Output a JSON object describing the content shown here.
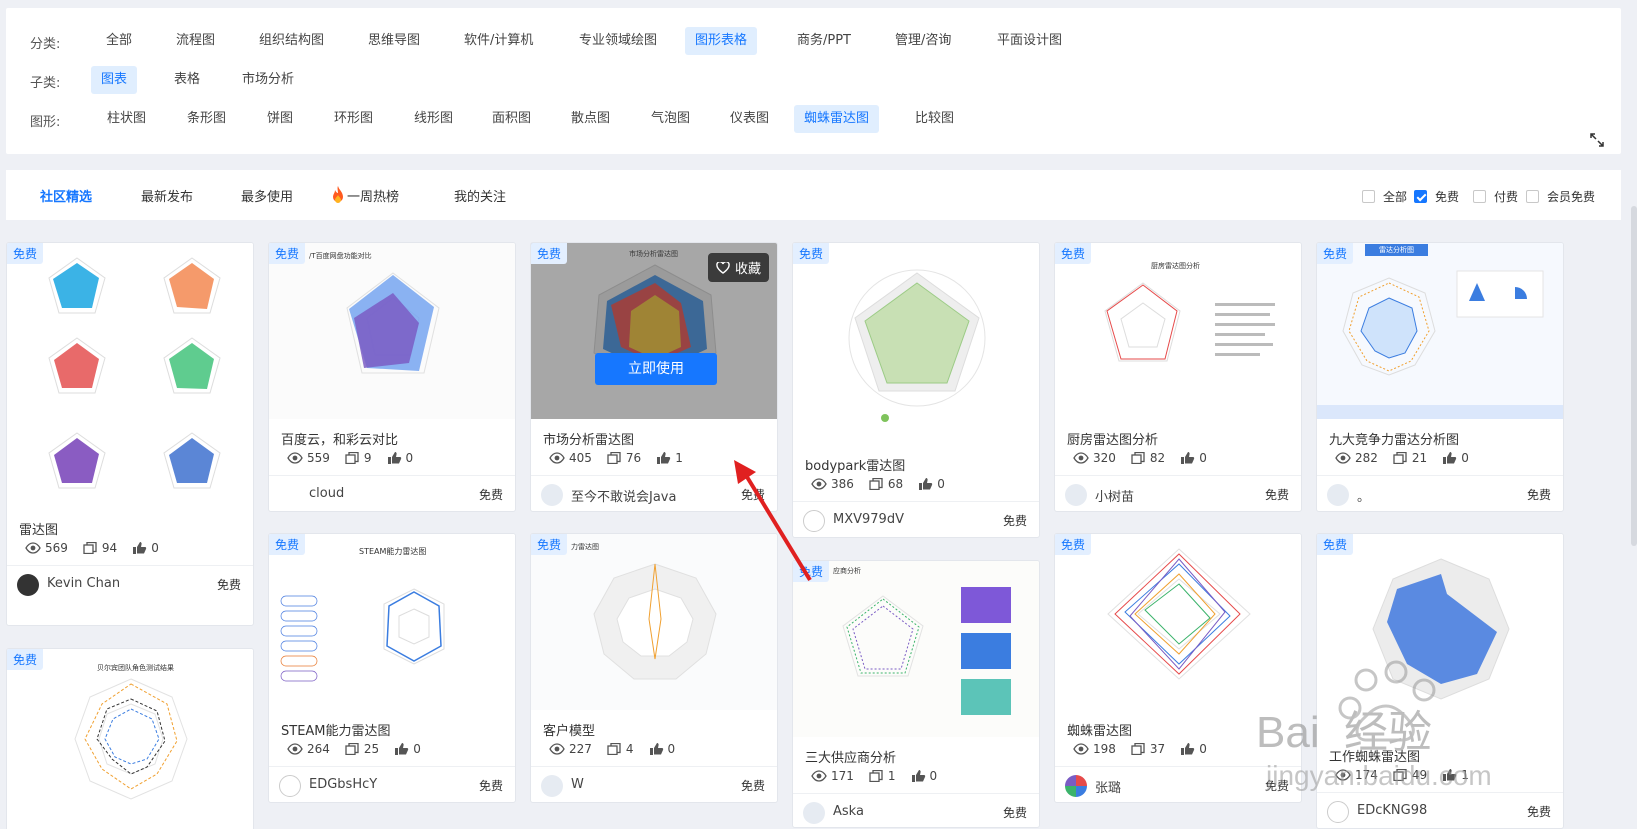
{
  "filters": {
    "category_label": "分类:",
    "categories": [
      "全部",
      "流程图",
      "组织结构图",
      "思维导图",
      "软件/计算机",
      "专业领域绘图",
      "图形表格",
      "商务/PPT",
      "管理/咨询",
      "平面设计图"
    ],
    "subcategory_label": "子类:",
    "subcategories": [
      "图表",
      "表格",
      "市场分析"
    ],
    "shape_label": "图形:",
    "shapes": [
      "柱状图",
      "条形图",
      "饼图",
      "环形图",
      "线形图",
      "面积图",
      "散点图",
      "气泡图",
      "仪表图",
      "蜘蛛雷达图",
      "比较图"
    ]
  },
  "tabs": [
    "社区精选",
    "最新发布",
    "最多使用",
    "一周热榜",
    "我的关注"
  ],
  "price_filters": [
    {
      "label": "全部",
      "checked": false
    },
    {
      "label": "免费",
      "checked": true
    },
    {
      "label": "付费",
      "checked": false
    },
    {
      "label": "会员免费",
      "checked": false
    }
  ],
  "badge_label": "免费",
  "overlay": {
    "favorite_label": "收藏",
    "use_label": "立即使用"
  },
  "cards": [
    {
      "title": "雷达图",
      "views": "569",
      "copies": "94",
      "likes": "0",
      "author": "Kevin Chan",
      "price": "免费"
    },
    {
      "title": "百度云，和彩云对比",
      "views": "559",
      "copies": "9",
      "likes": "0",
      "author": "cloud",
      "price": "免费"
    },
    {
      "title": "市场分析雷达图",
      "views": "405",
      "copies": "76",
      "likes": "1",
      "author": "至今不敢说会Java",
      "price": "免费"
    },
    {
      "title": "bodypark雷达图",
      "views": "386",
      "copies": "68",
      "likes": "0",
      "author": "MXV979dV",
      "price": "免费"
    },
    {
      "title": "厨房雷达图分析",
      "views": "320",
      "copies": "82",
      "likes": "0",
      "author": "小树苗",
      "price": "免费"
    },
    {
      "title": "九大竞争力雷达分析图",
      "views": "282",
      "copies": "21",
      "likes": "0",
      "author": "。",
      "price": "免费"
    },
    {
      "title": "STEAM能力雷达图",
      "views": "264",
      "copies": "25",
      "likes": "0",
      "author": "EDGbsHcY",
      "price": "免费"
    },
    {
      "title": "客户模型",
      "views": "227",
      "copies": "4",
      "likes": "0",
      "author": "W",
      "price": "免费"
    },
    {
      "title": "三大供应商分析",
      "views": "171",
      "copies": "1",
      "likes": "0",
      "author": "Aska",
      "price": "免费"
    },
    {
      "title": "蜘蛛雷达图",
      "views": "198",
      "copies": "37",
      "likes": "0",
      "author": "张璐",
      "price": "免费"
    },
    {
      "title": "工作蜘蛛雷达图",
      "views": "174",
      "copies": "49",
      "likes": "1",
      "author": "EDcKNG98",
      "price": "免费"
    }
  ],
  "thumb_texts": {
    "card1_heading": "/T百度网盘功能对比",
    "card3_heading": "市场分析雷达图",
    "card5_heading": "厨房雷达图分析",
    "card6_heading": "雷达分析图",
    "card7_heading": "STEAM能力雷达图",
    "card8_heading": "力雷达图",
    "card9_heading": "应商分析",
    "card12_heading": "贝尔宾团队角色测试结果"
  },
  "watermark": {
    "brand": "Bai  经验",
    "url": "jingyan.baidu.com"
  }
}
